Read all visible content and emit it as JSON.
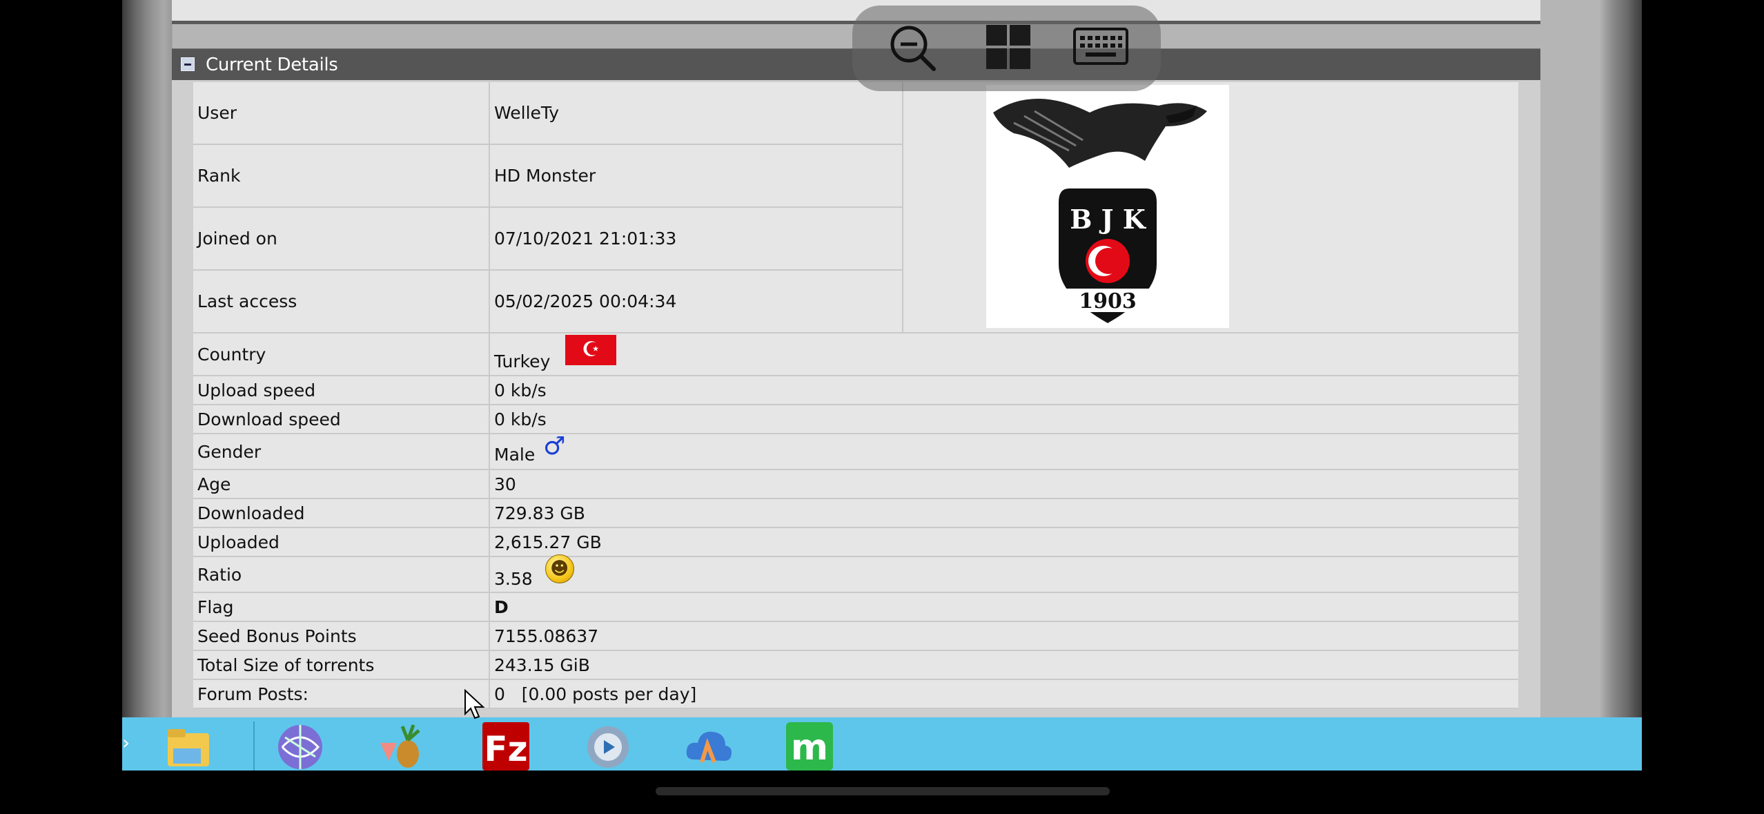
{
  "panel": {
    "title": "Current Details"
  },
  "rows": {
    "user": {
      "label": "User",
      "value": "WelleTy"
    },
    "rank": {
      "label": "Rank",
      "value": "HD Monster"
    },
    "joined": {
      "label": "Joined on",
      "value": "07/10/2021 21:01:33"
    },
    "last": {
      "label": "Last access",
      "value": "05/02/2025 00:04:34"
    },
    "country": {
      "label": "Country",
      "value": "Turkey",
      "flag_icon": "turkey-flag-icon"
    },
    "upload": {
      "label": "Upload speed",
      "value": "0 kb/s"
    },
    "download": {
      "label": "Download speed",
      "value": "0 kb/s"
    },
    "gender": {
      "label": "Gender",
      "value": "Male",
      "icon": "male-symbol-icon"
    },
    "age": {
      "label": "Age",
      "value": "30"
    },
    "downloaded": {
      "label": "Downloaded",
      "value": "729.83 GB"
    },
    "uploaded": {
      "label": "Uploaded",
      "value": "2,615.27 GB"
    },
    "ratio": {
      "label": "Ratio",
      "value": "3.58",
      "icon": "laughing-smiley-icon"
    },
    "flag": {
      "label": "Flag",
      "value": "D"
    },
    "bonus": {
      "label": "Seed Bonus Points",
      "value": "7155.08637"
    },
    "torrents": {
      "label": "Total Size of torrents",
      "value": "243.15 GiB"
    },
    "posts": {
      "label": "Forum Posts:",
      "value": "0   [0.00 posts per day]"
    }
  },
  "avatar": {
    "text_top": "B J K",
    "text_bottom": "1903"
  },
  "overlay": {
    "icons": [
      "zoom-out-icon",
      "windows-icon",
      "keyboard-icon"
    ]
  },
  "taskbar": {
    "icons": [
      "file-explorer-icon",
      "globe-app-icon",
      "pineapple-app-icon",
      "filezilla-icon",
      "settings-gear-icon",
      "cloud-app-icon",
      "m-app-icon"
    ]
  },
  "colors": {
    "header_bg": "#555555",
    "taskbar_bg": "#5ec6ea",
    "flag_red": "#e30a17",
    "male_blue": "#1a3fd6"
  }
}
